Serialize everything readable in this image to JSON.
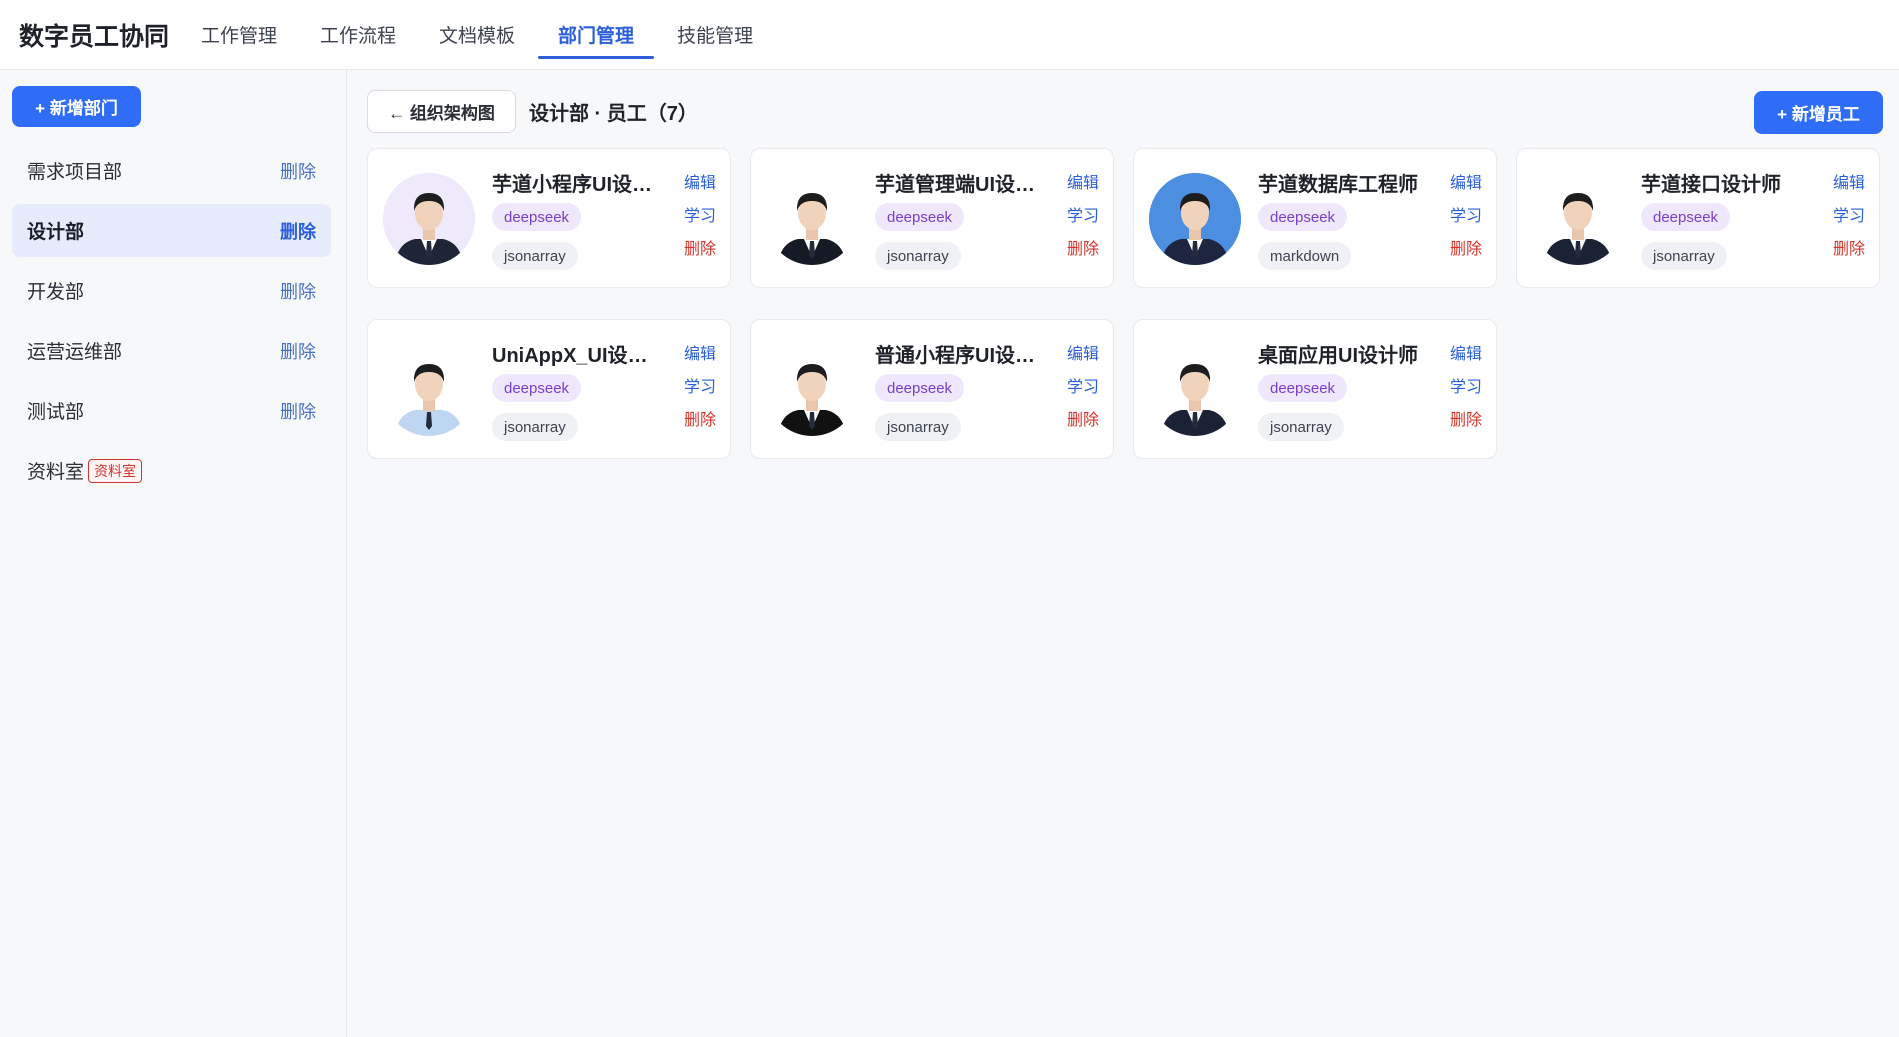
{
  "app": {
    "title": "数字员工协同"
  },
  "nav": {
    "tabs": [
      {
        "label": "工作管理",
        "active": false
      },
      {
        "label": "工作流程",
        "active": false
      },
      {
        "label": "文档模板",
        "active": false
      },
      {
        "label": "部门管理",
        "active": true
      },
      {
        "label": "技能管理",
        "active": false
      }
    ]
  },
  "sidebar": {
    "add_label": "+ 新增部门",
    "departments": [
      {
        "name": "需求项目部",
        "delete_label": "删除",
        "active": false
      },
      {
        "name": "设计部",
        "delete_label": "删除",
        "active": true
      },
      {
        "name": "开发部",
        "delete_label": "删除",
        "active": false
      },
      {
        "name": "运营运维部",
        "delete_label": "删除",
        "active": false
      },
      {
        "name": "测试部",
        "delete_label": "删除",
        "active": false
      },
      {
        "name": "资料室",
        "badge": "资料室",
        "active": false
      }
    ]
  },
  "main": {
    "back_label": "← 组织架构图",
    "title": "设计部 · 员工（7）",
    "add_label": "+ 新增员工",
    "action_labels": {
      "edit": "编辑",
      "learn": "学习",
      "delete": "删除"
    },
    "employees": [
      {
        "name": "芋道小程序UI设计师",
        "model": "deepseek",
        "skill": "jsonarray",
        "avatar_bg": "#eee9fb",
        "suit": "#1e2536",
        "shirt": "#ffffff"
      },
      {
        "name": "芋道管理端UI设计师",
        "model": "deepseek",
        "skill": "jsonarray",
        "avatar_bg": "#ffffff",
        "suit": "#161a25",
        "shirt": "#ffffff"
      },
      {
        "name": "芋道数据库工程师",
        "model": "deepseek",
        "skill": "markdown",
        "avatar_bg": "#4c8ee0",
        "suit": "#1d2540",
        "shirt": "#ffffff"
      },
      {
        "name": "芋道接口设计师",
        "model": "deepseek",
        "skill": "jsonarray",
        "avatar_bg": "#ffffff",
        "suit": "#1b2235",
        "shirt": "#ffffff"
      },
      {
        "name": "UniAppX_UI设计师",
        "model": "deepseek",
        "skill": "jsonarray",
        "avatar_bg": "#ffffff",
        "suit": "#bfd6f2",
        "shirt": "#bfd6f2"
      },
      {
        "name": "普通小程序UI设计师",
        "model": "deepseek",
        "skill": "jsonarray",
        "avatar_bg": "#ffffff",
        "suit": "#111111",
        "shirt": "#ffffff"
      },
      {
        "name": "桌面应用UI设计师",
        "model": "deepseek",
        "skill": "jsonarray",
        "avatar_bg": "#ffffff",
        "suit": "#1b2235",
        "shirt": "#ffffff"
      }
    ]
  }
}
